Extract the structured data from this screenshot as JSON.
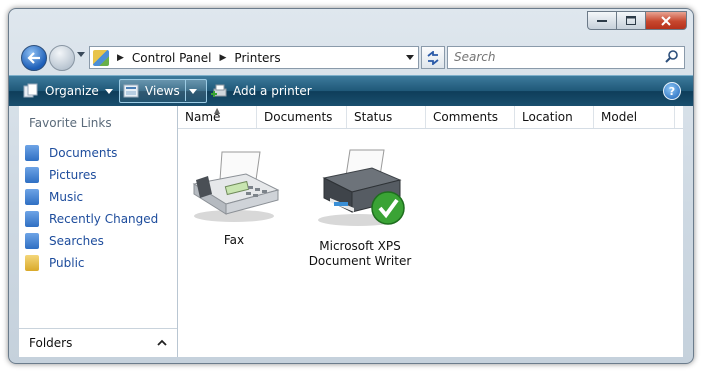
{
  "window": {
    "caption_buttons": [
      "minimize",
      "maximize",
      "close"
    ]
  },
  "address": {
    "crumbs": [
      "Control Panel",
      "Printers"
    ]
  },
  "search": {
    "placeholder": "Search"
  },
  "toolbar": {
    "organize_label": "Organize",
    "views_label": "Views",
    "add_printer_label": "Add a printer",
    "help_label": "?"
  },
  "sidebar": {
    "title": "Favorite Links",
    "items": [
      {
        "label": "Documents",
        "icon": "documents-icon",
        "color": "#3f7fd0"
      },
      {
        "label": "Pictures",
        "icon": "pictures-icon",
        "color": "#3f7fd0"
      },
      {
        "label": "Music",
        "icon": "music-icon",
        "color": "#3f7fd0"
      },
      {
        "label": "Recently Changed",
        "icon": "recently-changed-icon",
        "color": "#3f7fd0"
      },
      {
        "label": "Searches",
        "icon": "searches-icon",
        "color": "#3f7fd0"
      },
      {
        "label": "Public",
        "icon": "public-folder-icon",
        "color": "#e2b93b"
      }
    ],
    "folders_label": "Folders"
  },
  "columns": [
    "Name",
    "Documents",
    "Status",
    "Comments",
    "Location",
    "Model"
  ],
  "printers": [
    {
      "name": "Fax",
      "icon": "fax-icon",
      "default": false
    },
    {
      "name_line1": "Microsoft XPS",
      "name_line2": "Document Writer",
      "icon": "printer-icon",
      "default": true
    }
  ],
  "colors": {
    "toolbar": "#1f5878",
    "link": "#1d4c9c",
    "default_check": "#3aa335"
  }
}
